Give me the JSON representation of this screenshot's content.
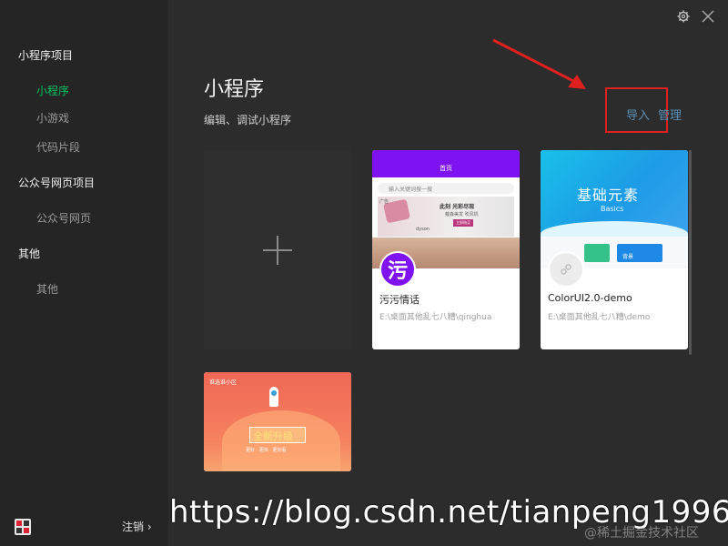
{
  "sidebar": {
    "groups": [
      {
        "label": "小程序项目",
        "items": [
          "小程序",
          "小游戏",
          "代码片段"
        ]
      },
      {
        "label": "公众号网页项目",
        "items": [
          "公众号网页"
        ]
      },
      {
        "label": "其他",
        "items": [
          "其他"
        ]
      }
    ],
    "logout_label": "注销 ›"
  },
  "main": {
    "title": "小程序",
    "subtitle": "编辑、调试小程序",
    "import_label": "导入",
    "manage_label": "管理"
  },
  "projects": [
    {
      "name": "污污情话",
      "path": "E:\\桌面其他乱七八糟\\qinghua",
      "preview": {
        "header": "首页",
        "search_placeholder": "输入关键词搜一搜",
        "ad_tag": "广告",
        "ad_line1": "此刻 光彩尽现",
        "ad_line2": "戴森美发 吹风机",
        "ad_button": "立即购买",
        "ad_brand": "dyson",
        "badge_char": "污"
      }
    },
    {
      "name": "ColorUI2.0-demo",
      "path": "E:\\桌面其他乱七八糟\\demo",
      "preview": {
        "banner_title": "基础元素",
        "banner_sub": "Basics",
        "tile_label": "背景"
      }
    },
    {
      "name": "",
      "path": "",
      "preview": {
        "top_text": "谁选谁小区",
        "center_text": "全新升级",
        "sub_text": "更好 · 更快 · 更好看"
      }
    }
  ],
  "watermark": {
    "url": "https://blog.csdn.net/tianpeng1996",
    "sub": "@稀土掘金技术社区"
  },
  "colors": {
    "active": "#07c160",
    "link": "#5a8fb4",
    "highlight": "#e0201e",
    "arrow": "#e0201e"
  }
}
